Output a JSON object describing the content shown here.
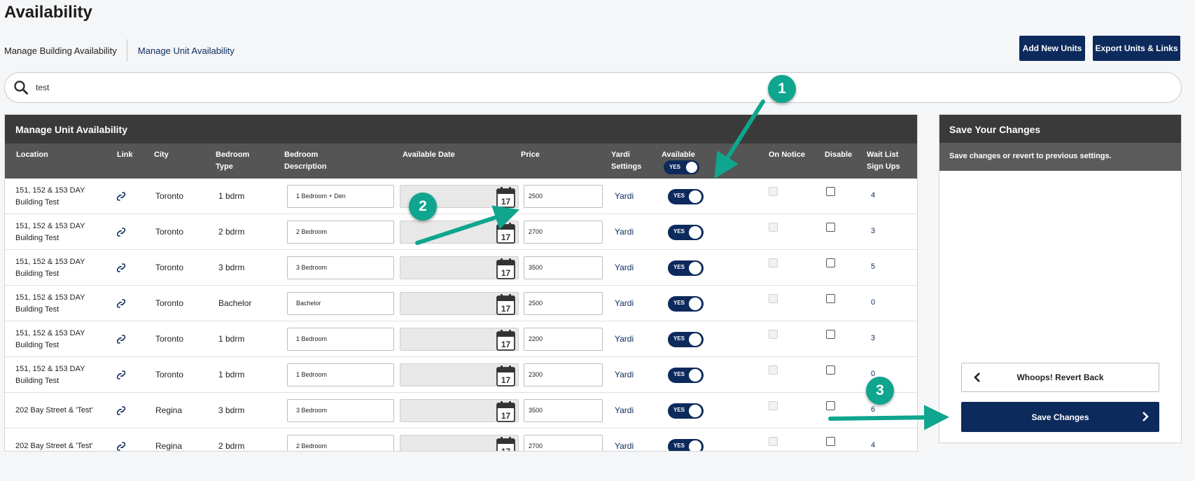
{
  "page": {
    "title": "Availability"
  },
  "subnav": {
    "building": "Manage Building Availability",
    "unit": "Manage Unit Availability"
  },
  "actions": {
    "add_units": "Add New Units",
    "export": "Export Units & Links"
  },
  "search": {
    "value": "test",
    "icon": "search-icon"
  },
  "table": {
    "title": "Manage Unit Availability",
    "headers": {
      "location": "Location",
      "link": "Link",
      "city": "City",
      "bedroom_type_1": "Bedroom",
      "bedroom_type_2": "Type",
      "bedroom_desc_1": "Bedroom",
      "bedroom_desc_2": "Description",
      "available_date": "Available Date",
      "price": "Price",
      "yardi_1": "Yardi",
      "yardi_2": "Settings",
      "available": "Available",
      "available_toggle": "YES",
      "on_notice": "On Notice",
      "disable": "Disable",
      "waitlist_1": "Wait List",
      "waitlist_2": "Sign Ups"
    },
    "rows": [
      {
        "loc1": "151, 152 & 153 DAY",
        "loc2": "Building Test",
        "city": "Toronto",
        "type": "1 bdrm",
        "desc": "1 Bedroom + Den",
        "date": "",
        "price": "2500",
        "yardi": "Yardi",
        "available": "YES",
        "on_notice": false,
        "disable": false,
        "waitlist": "4"
      },
      {
        "loc1": "151, 152 & 153 DAY",
        "loc2": "Building Test",
        "city": "Toronto",
        "type": "2 bdrm",
        "desc": "2 Bedroom",
        "date": "",
        "price": "2700",
        "yardi": "Yardi",
        "available": "YES",
        "on_notice": false,
        "disable": false,
        "waitlist": "3"
      },
      {
        "loc1": "151, 152 & 153 DAY",
        "loc2": "Building Test",
        "city": "Toronto",
        "type": "3 bdrm",
        "desc": "3 Bedroom",
        "date": "",
        "price": "3500",
        "yardi": "Yardi",
        "available": "YES",
        "on_notice": false,
        "disable": false,
        "waitlist": "5"
      },
      {
        "loc1": "151, 152 & 153 DAY",
        "loc2": "Building Test",
        "city": "Toronto",
        "type": "Bachelor",
        "desc": "Bachelor",
        "date": "",
        "price": "2500",
        "yardi": "Yardi",
        "available": "YES",
        "on_notice": false,
        "disable": false,
        "waitlist": "0"
      },
      {
        "loc1": "151, 152 & 153 DAY",
        "loc2": "Building Test",
        "city": "Toronto",
        "type": "1 bdrm",
        "desc": "1 Bedroom",
        "date": "",
        "price": "2200",
        "yardi": "Yardi",
        "available": "YES",
        "on_notice": false,
        "disable": false,
        "waitlist": "3"
      },
      {
        "loc1": "151, 152 & 153 DAY",
        "loc2": "Building Test",
        "city": "Toronto",
        "type": "1 bdrm",
        "desc": "1 Bedroom",
        "date": "",
        "price": "2300",
        "yardi": "Yardi",
        "available": "YES",
        "on_notice": false,
        "disable": false,
        "waitlist": "0"
      },
      {
        "loc1": "202 Bay Street & 'Test'",
        "loc2": "",
        "city": "Regina",
        "type": "3 bdrm",
        "desc": "3 Bedroom",
        "date": "",
        "price": "3500",
        "yardi": "Yardi",
        "available": "YES",
        "on_notice": false,
        "disable": false,
        "waitlist": "6"
      },
      {
        "loc1": "202 Bay Street & 'Test'",
        "loc2": "",
        "city": "Regina",
        "type": "2 bdrm",
        "desc": "2 Bedroom",
        "date": "",
        "price": "2700",
        "yardi": "Yardi",
        "available": "YES",
        "on_notice": false,
        "disable": false,
        "waitlist": "4"
      }
    ],
    "calendar_day": "17"
  },
  "save_panel": {
    "title": "Save Your Changes",
    "subtitle": "Save changes or revert to previous settings.",
    "revert": "Whoops! Revert Back",
    "save": "Save Changes"
  },
  "annotations": {
    "badge1": "1",
    "badge2": "2",
    "badge3": "3",
    "color": "#0fa58e"
  },
  "colors": {
    "navy": "#0d2a5c",
    "header_dark": "#3a3a3a",
    "header_mid": "#555555",
    "teal": "#0fa58e"
  }
}
